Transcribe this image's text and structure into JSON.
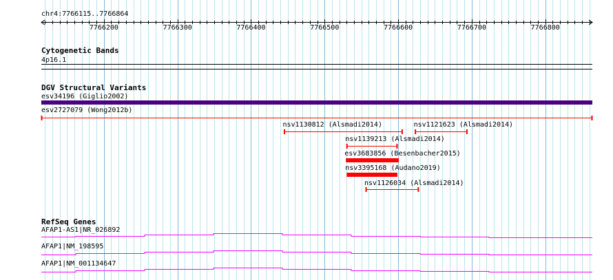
{
  "ruler": {
    "title": "chr4:7766115..7766864",
    "start": 7766115,
    "end": 7766864,
    "ticks": [
      "7766200",
      "7766300",
      "7766400",
      "7766500",
      "7766600",
      "7766700",
      "7766800"
    ],
    "tick_values": [
      7766200,
      7766300,
      7766400,
      7766500,
      7766600,
      7766700,
      7766800
    ]
  },
  "cyto": {
    "title": "Cytogenetic Bands",
    "band": "4p16.1"
  },
  "dgv": {
    "title": "DGV Structural Variants",
    "features": [
      {
        "label": "esv34196 (Giglio2002)",
        "start": 7766115,
        "end": 7766864,
        "style": "thick",
        "color": "#4b0082"
      },
      {
        "label": "esv2727079 (Wong2012b)",
        "start": 7766115,
        "end": 7766864,
        "style": "line",
        "color": "#ff0000"
      },
      {
        "label": "nsv1130812 (Alsmadi2014)",
        "start": 7766445,
        "end": 7766606,
        "style": "line",
        "color": "#ff0000"
      },
      {
        "label": "nsv1121623 (Alsmadi2014)",
        "start": 7766623,
        "end": 7766694,
        "style": "line",
        "color": "#ff0000"
      },
      {
        "label": "nsv1139213 (Alsmadi2014)",
        "start": 7766530,
        "end": 7766599,
        "style": "line",
        "color": "#ff0000"
      },
      {
        "label": "esv3683856 (Besenbacher2015)",
        "start": 7766529,
        "end": 7766601,
        "style": "thick",
        "color": "#ff0000"
      },
      {
        "label": "nsv3395168 (Audano2019)",
        "start": 7766530,
        "end": 7766599,
        "style": "thick",
        "color": "#ff0000"
      },
      {
        "label": "nsv1126034 (Alsmadi2014)",
        "start": 7766556,
        "end": 7766628,
        "style": "line",
        "color": "#ff0000"
      }
    ]
  },
  "refseq": {
    "title": "RefSeq Genes",
    "genes": [
      "AFAP1-AS1|NR_026892",
      "AFAP1|NM_198595",
      "AFAP1|NM_001134647"
    ],
    "color": "#ff00ff"
  }
}
